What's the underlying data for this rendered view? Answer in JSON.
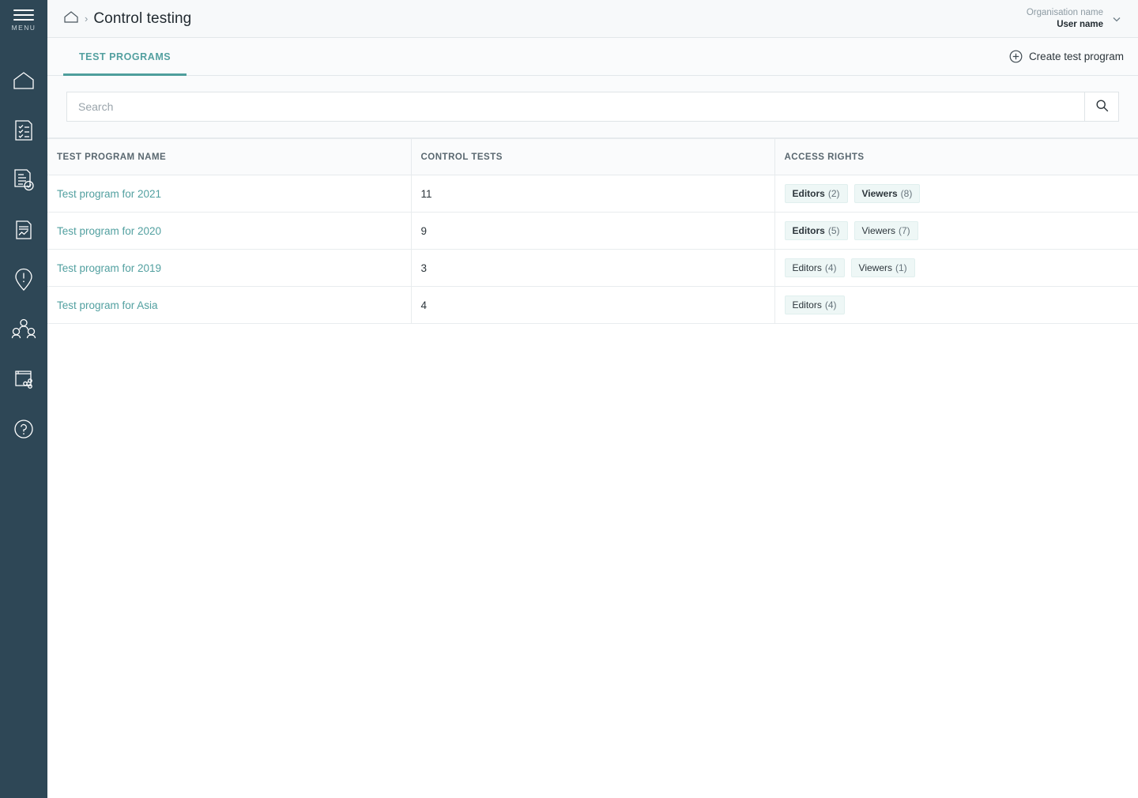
{
  "sidebar": {
    "menu_label": "MENU",
    "menu_icon": "hamburger-icon",
    "items": [
      {
        "icon": "home-icon",
        "name": "home"
      },
      {
        "icon": "checklist-document-icon",
        "name": "checklists"
      },
      {
        "icon": "document-check-icon",
        "name": "control-testing"
      },
      {
        "icon": "document-chart-icon",
        "name": "reports"
      },
      {
        "icon": "alert-pin-icon",
        "name": "issues"
      },
      {
        "icon": "people-icon",
        "name": "users"
      },
      {
        "icon": "library-share-icon",
        "name": "library"
      },
      {
        "icon": "help-circle-icon",
        "name": "help"
      }
    ]
  },
  "topbar": {
    "breadcrumb": {
      "home_icon": "home-icon",
      "separator": "›",
      "title": "Control testing"
    },
    "user": {
      "organisation": "Organisation name",
      "name": "User name",
      "chevron_icon": "chevron-down-icon"
    }
  },
  "tabbar": {
    "tabs": [
      {
        "label": "TEST PROGRAMS",
        "active": true
      }
    ],
    "create_button": {
      "label": "Create test program",
      "icon": "plus-circle-icon"
    }
  },
  "search": {
    "placeholder": "Search",
    "value": "",
    "button_icon": "search-icon"
  },
  "table": {
    "columns": [
      "TEST PROGRAM NAME",
      "CONTROL TESTS",
      "ACCESS RIGHTS"
    ],
    "rows": [
      {
        "name": "Test program for 2021",
        "control_tests": "11",
        "access": [
          {
            "label": "Editors",
            "count": "(2)",
            "strong": true
          },
          {
            "label": "Viewers",
            "count": "(8)",
            "strong": true
          }
        ]
      },
      {
        "name": "Test program for 2020",
        "control_tests": "9",
        "access": [
          {
            "label": "Editors",
            "count": "(5)",
            "strong": true
          },
          {
            "label": "Viewers",
            "count": "(7)",
            "strong": false
          }
        ]
      },
      {
        "name": "Test program for 2019",
        "control_tests": "3",
        "access": [
          {
            "label": "Editors",
            "count": "(4)",
            "strong": false
          },
          {
            "label": "Viewers",
            "count": "(1)",
            "strong": false
          }
        ]
      },
      {
        "name": "Test program for Asia",
        "control_tests": "4",
        "access": [
          {
            "label": "Editors",
            "count": "(4)",
            "strong": false
          }
        ]
      }
    ]
  },
  "colors": {
    "sidebar_bg": "#2e4756",
    "accent_teal": "#4e9e9c",
    "link_teal": "#52a0a0",
    "badge_bg": "#eef7f6",
    "header_bg": "#f7f9fa",
    "border": "#e6eaed"
  }
}
